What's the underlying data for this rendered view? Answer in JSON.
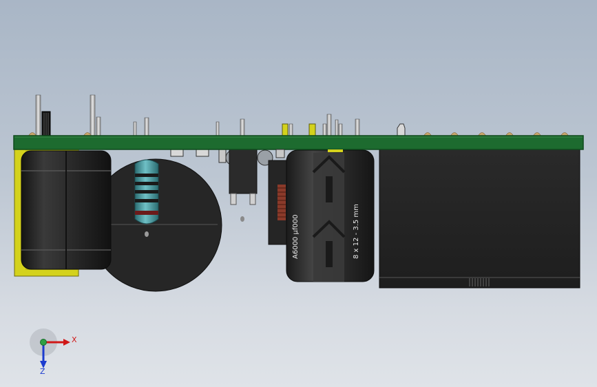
{
  "capacitor": {
    "marking_rating": "A6000 µf000",
    "marking_size": "8 x 12 - 3.5 mm"
  },
  "triad": {
    "x_label": "X",
    "z_label": "Z",
    "x_color": "#d01818",
    "z_color": "#1c3ccf",
    "origin_color": "#2ea043"
  },
  "colors": {
    "pcb": "#1d6b2f",
    "pcb_edge": "#0f4a1d",
    "component_black": "#242424",
    "transformer_yellow": "#d4d21c",
    "resistor_body": "#3f8f96",
    "background_top": "#a9b6c6",
    "background_bottom": "#dfe3e8"
  }
}
